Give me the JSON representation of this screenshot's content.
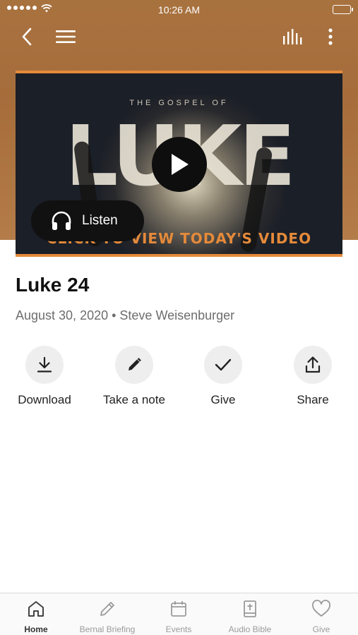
{
  "status_bar": {
    "time": "10:26 AM"
  },
  "header": {
    "back_icon": "chevron-left-icon",
    "menu_icon": "hamburger-icon",
    "audio_icon": "equalizer-icon",
    "more_icon": "vertical-ellipsis-icon"
  },
  "video": {
    "kicker": "THE GOSPEL OF",
    "title_art": "LUKE",
    "cta": "CLICK TO VIEW TODAY'S VIDEO",
    "listen_label": "Listen",
    "accent_color": "#e58a3a"
  },
  "sermon": {
    "title": "Luke 24",
    "meta": "August 30, 2020 • Steve Weisenburger"
  },
  "actions": [
    {
      "label": "Download",
      "icon": "download-icon"
    },
    {
      "label": "Take a note",
      "icon": "pencil-icon"
    },
    {
      "label": "Give",
      "icon": "checkmark-icon"
    },
    {
      "label": "Share",
      "icon": "share-icon"
    }
  ],
  "tabbar": [
    {
      "label": "Home",
      "icon": "home-icon",
      "active": true
    },
    {
      "label": "Bernal Briefing",
      "icon": "pencil-icon",
      "active": false
    },
    {
      "label": "Events",
      "icon": "calendar-icon",
      "active": false
    },
    {
      "label": "Audio Bible",
      "icon": "bible-icon",
      "active": false
    },
    {
      "label": "Give",
      "icon": "heart-icon",
      "active": false
    }
  ],
  "colors": {
    "header_brown": "#a66d3b",
    "accent": "#e58a3a"
  }
}
